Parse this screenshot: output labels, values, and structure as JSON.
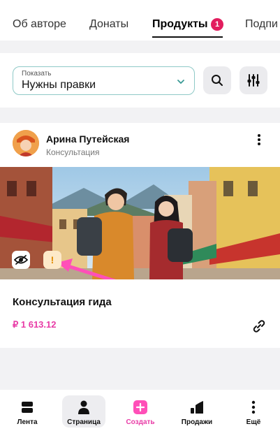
{
  "tabs": [
    {
      "label": "Об авторе"
    },
    {
      "label": "Донаты"
    },
    {
      "label": "Продукты",
      "badge": "1"
    },
    {
      "label": "Подпи"
    }
  ],
  "filter": {
    "label": "Показать",
    "value": "Нужны правки"
  },
  "card": {
    "author": "Арина Путейская",
    "subtitle": "Консультация",
    "product_title": "Консультация гида",
    "price": "₽ 1 613.12",
    "warning_glyph": "!"
  },
  "bottom_nav": [
    {
      "label": "Лента",
      "icon": "feed-icon"
    },
    {
      "label": "Страница",
      "icon": "profile-icon"
    },
    {
      "label": "Создать",
      "icon": "plus-icon"
    },
    {
      "label": "Продажи",
      "icon": "sales-chart-icon"
    },
    {
      "label": "Ещё",
      "icon": "more-vertical-icon"
    }
  ],
  "colors": {
    "accent_pink": "#e83ba6",
    "badge_red": "#e21d5e",
    "select_border": "#8fc9c7"
  }
}
